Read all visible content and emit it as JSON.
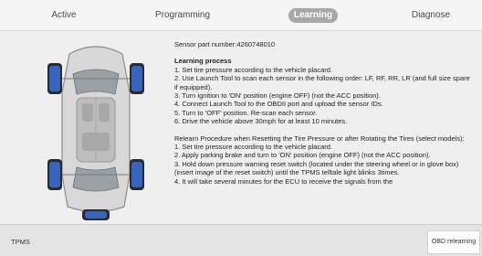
{
  "tabs": [
    {
      "label": "Active"
    },
    {
      "label": "Programming"
    },
    {
      "label": "Learning"
    },
    {
      "label": "Diagnose"
    }
  ],
  "content": {
    "sensor_part": "Sensor part number:4260748010",
    "heading": "Learning process",
    "steps": [
      "1. Set tire pressure according to the vehicle placard.",
      "2. Use Launch Tool to scan each sensor in the following order: LF, RF, RR, LR (and full size spare if equipped).",
      "3. Turn ignition to 'ON' position (engine OFF) (not the ACC position).",
      "4. Connect Launch Tool to the OBDII port and upload the sensor IDs.",
      "5. Turn to 'OFF' position. Re-scan each sensor.",
      "6. Drive the vehicle above 30mph for at least 10 minutes."
    ],
    "relearn_heading": "Relearn Procedure when Resetting the Tire Pressure or after Rotating the Tires (select models):",
    "relearn_steps": [
      "1. Set tire pressure according to the vehicle placard.",
      "2. Apply parking brake and turn to 'ON' position (engine OFF) (not the ACC position).",
      "3. Hold down pressure warning reset switch (located under the steering wheel or in glove box) (insert image of the reset switch) until the TPMS telltale light blinks 3times.",
      "4. It will take several minutes for the ECU to receive the signals from the"
    ]
  },
  "bottom": {
    "label": "TPMS",
    "button": "OBD relearning"
  },
  "colors": {
    "tire_highlight": "#3a6fd8",
    "active_tab": "#a8a8a8"
  }
}
